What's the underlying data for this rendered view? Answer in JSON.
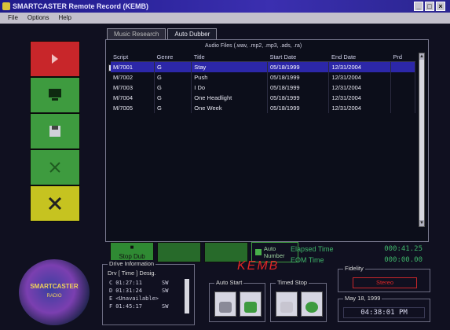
{
  "window": {
    "title": "SMARTCASTER Remote Record (KEMB)"
  },
  "menu": {
    "items": [
      "File",
      "Options",
      "Help"
    ]
  },
  "tabs": [
    "Music Research",
    "Auto Dubber"
  ],
  "panel": {
    "filetypes": "Audio Files (.wav, .mp2, .mp3, .ads, .ra)",
    "columns": [
      "Script",
      "Genre",
      "Title",
      "Start Date",
      "End Date",
      "Prd"
    ],
    "rows": [
      {
        "script": "M/7001",
        "genre": "G",
        "title": "Stay",
        "start": "05/18/1999",
        "end": "12/31/2004",
        "selected": true
      },
      {
        "script": "M/7002",
        "genre": "G",
        "title": "Push",
        "start": "05/18/1999",
        "end": "12/31/2004",
        "selected": false
      },
      {
        "script": "M/7003",
        "genre": "G",
        "title": "I Do",
        "start": "05/18/1999",
        "end": "12/31/2004",
        "selected": false
      },
      {
        "script": "M/7004",
        "genre": "G",
        "title": "One Headlight",
        "start": "05/18/1999",
        "end": "12/31/2004",
        "selected": false
      },
      {
        "script": "M/7005",
        "genre": "G",
        "title": "One Week",
        "start": "05/18/1999",
        "end": "12/31/2004",
        "selected": false
      }
    ]
  },
  "buttons": {
    "stop_dub": "Stop Dub",
    "auto_number": "Auto Number"
  },
  "timers": {
    "elapsed_label": "Elapsed Time",
    "elapsed_value": "000:41.25",
    "eom_label": "EOM Time",
    "eom_value": "000:00.00"
  },
  "logo": {
    "title": "SMARTCASTER",
    "subtitle": "RADIO"
  },
  "drive_info": {
    "legend": "Drive Information",
    "header": "Drv [ Time ] Desig.",
    "rows": [
      {
        "drive": "C",
        "time": "01:27:11",
        "desig": "SW"
      },
      {
        "drive": "D",
        "time": "01:31:24",
        "desig": "SW"
      },
      {
        "drive": "E",
        "time": "<Unavailable>",
        "desig": ""
      },
      {
        "drive": "F",
        "time": "01:45:17",
        "desig": "SW"
      }
    ]
  },
  "station": "KEMB",
  "auto_start": {
    "legend": "Auto Start"
  },
  "timed_stop": {
    "legend": "Timed Stop"
  },
  "fidelity": {
    "legend": "Fidelity",
    "value": "Stereo"
  },
  "clock": {
    "legend": "May 18, 1999",
    "value": "04:38:01 PM"
  },
  "colors": {
    "selection": "#2c27a8",
    "sidebar_red": "#c8262a",
    "sidebar_green": "#3e9b3f",
    "sidebar_yellow": "#c6c320",
    "timer_green": "#3fb56a",
    "station_red": "#e02626"
  },
  "icons": [
    "record-icon",
    "computer-icon",
    "disk-icon",
    "cut-icon",
    "close-icon"
  ]
}
